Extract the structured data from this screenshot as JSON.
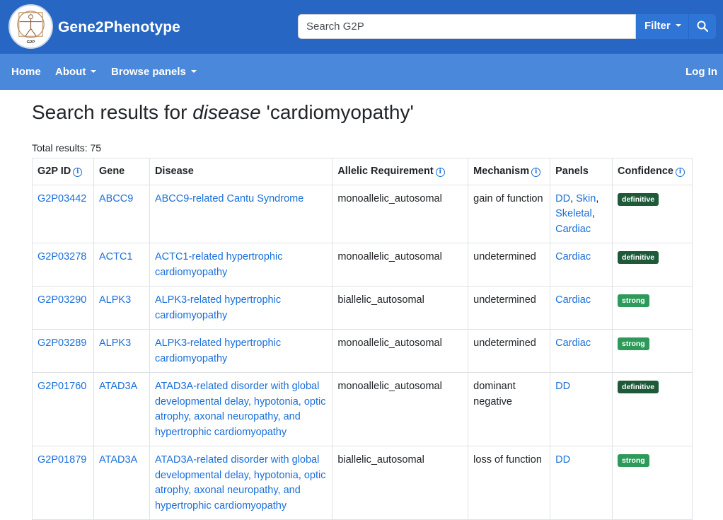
{
  "header": {
    "brand": "Gene2Phenotype",
    "logo_text": "G2P",
    "search_placeholder": "Search G2P",
    "filter_label": "Filter"
  },
  "nav": {
    "home": "Home",
    "about": "About",
    "browse": "Browse panels",
    "login": "Log In"
  },
  "page": {
    "title_prefix": "Search results for ",
    "title_em": "disease",
    "title_suffix": " 'cardiomyopathy'",
    "total": "Total results: 75"
  },
  "colors": {
    "header_bg": "#2767c3",
    "nav_bg": "#4a88dc",
    "link": "#1a6fd9",
    "badge_definitive": "#1e5a39",
    "badge_strong": "#2e9a59"
  },
  "table": {
    "headers": {
      "id": "G2P ID",
      "gene": "Gene",
      "disease": "Disease",
      "allelic": "Allelic Requirement",
      "mechanism": "Mechanism",
      "panels": "Panels",
      "confidence": "Confidence"
    },
    "rows": [
      {
        "id": "G2P03442",
        "gene": "ABCC9",
        "disease": "ABCC9-related Cantu Syndrome",
        "allelic": "monoallelic_autosomal",
        "mechanism": "gain of function",
        "panels": [
          "DD",
          "Skin",
          "Skeletal",
          "Cardiac"
        ],
        "confidence": "definitive"
      },
      {
        "id": "G2P03278",
        "gene": "ACTC1",
        "disease": "ACTC1-related hypertrophic cardiomyopathy",
        "allelic": "monoallelic_autosomal",
        "mechanism": "undetermined",
        "panels": [
          "Cardiac"
        ],
        "confidence": "definitive"
      },
      {
        "id": "G2P03290",
        "gene": "ALPK3",
        "disease": "ALPK3-related hypertrophic cardiomyopathy",
        "allelic": "biallelic_autosomal",
        "mechanism": "undetermined",
        "panels": [
          "Cardiac"
        ],
        "confidence": "strong"
      },
      {
        "id": "G2P03289",
        "gene": "ALPK3",
        "disease": "ALPK3-related hypertrophic cardiomyopathy",
        "allelic": "monoallelic_autosomal",
        "mechanism": "undetermined",
        "panels": [
          "Cardiac"
        ],
        "confidence": "strong"
      },
      {
        "id": "G2P01760",
        "gene": "ATAD3A",
        "disease": "ATAD3A-related disorder with global developmental delay, hypotonia, optic atrophy, axonal neuropathy, and hypertrophic cardiomyopathy",
        "allelic": "monoallelic_autosomal",
        "mechanism": "dominant negative",
        "panels": [
          "DD"
        ],
        "confidence": "definitive"
      },
      {
        "id": "G2P01879",
        "gene": "ATAD3A",
        "disease": "ATAD3A-related disorder with global developmental delay, hypotonia, optic atrophy, axonal neuropathy, and hypertrophic cardiomyopathy",
        "allelic": "biallelic_autosomal",
        "mechanism": "loss of function",
        "panels": [
          "DD"
        ],
        "confidence": "strong"
      }
    ]
  }
}
